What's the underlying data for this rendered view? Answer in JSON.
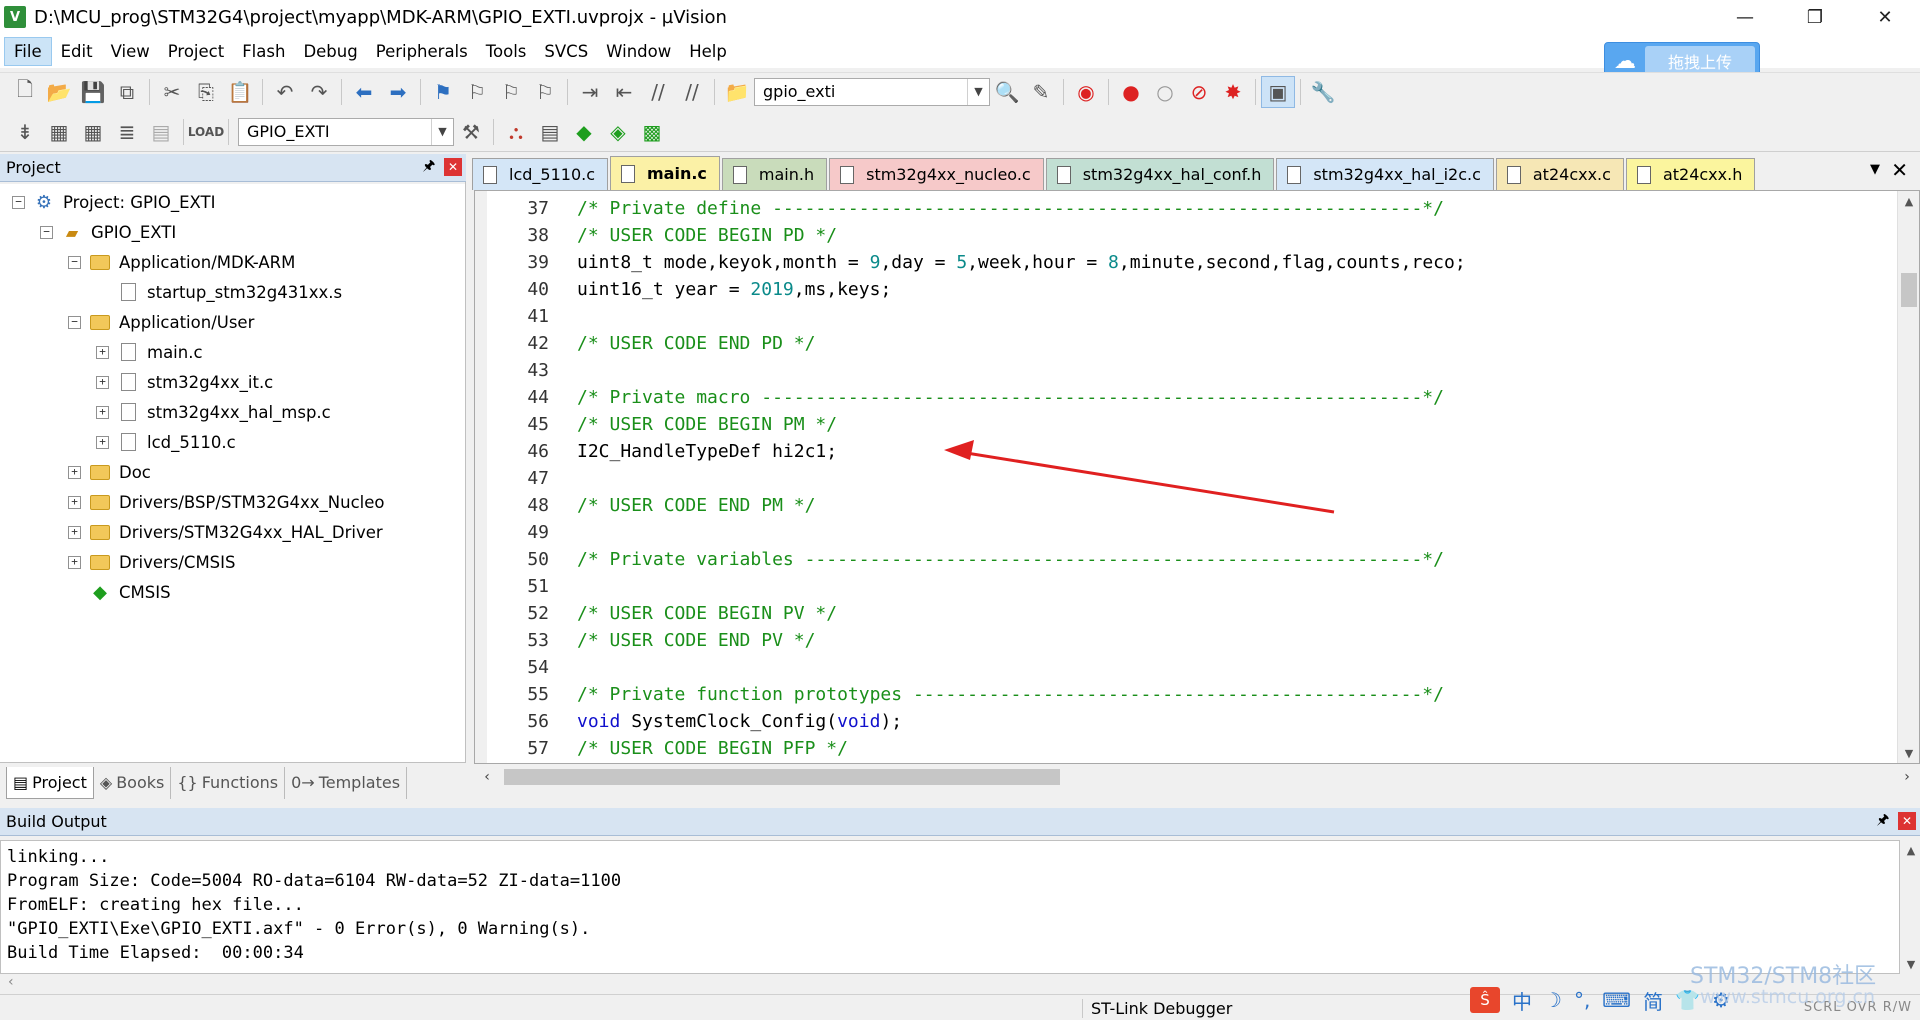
{
  "title": "D:\\MCU_prog\\STM32G4\\project\\myapp\\MDK-ARM\\GPIO_EXTI.uvprojx - µVision",
  "app_icon_label": "V",
  "window_controls": {
    "minimize": "—",
    "maximize": "❐",
    "close": "✕"
  },
  "menu": [
    "File",
    "Edit",
    "View",
    "Project",
    "Flash",
    "Debug",
    "Peripherals",
    "Tools",
    "SVCS",
    "Window",
    "Help"
  ],
  "upload_button": {
    "label": "拖拽上传"
  },
  "toolbar1": {
    "find_combo": "gpio_exti"
  },
  "toolbar2": {
    "target_combo": "GPIO_EXTI"
  },
  "project_panel": {
    "title": "Project",
    "pin": "🖈",
    "close": "✕",
    "tree": [
      {
        "level": 0,
        "exp": "⊟",
        "icon": "project",
        "label": "Project: GPIO_EXTI"
      },
      {
        "level": 1,
        "exp": "⊟",
        "icon": "group",
        "label": "GPIO_EXTI"
      },
      {
        "level": 2,
        "exp": "⊟",
        "icon": "folder",
        "label": "Application/MDK-ARM"
      },
      {
        "level": 3,
        "exp": "",
        "icon": "file",
        "label": "startup_stm32g431xx.s"
      },
      {
        "level": 2,
        "exp": "⊟",
        "icon": "folder",
        "label": "Application/User"
      },
      {
        "level": 3,
        "exp": "⊞",
        "icon": "file",
        "label": "main.c"
      },
      {
        "level": 3,
        "exp": "⊞",
        "icon": "file",
        "label": "stm32g4xx_it.c"
      },
      {
        "level": 3,
        "exp": "⊞",
        "icon": "file",
        "label": "stm32g4xx_hal_msp.c"
      },
      {
        "level": 3,
        "exp": "⊞",
        "icon": "file",
        "label": "lcd_5110.c"
      },
      {
        "level": 2,
        "exp": "⊞",
        "icon": "folder",
        "label": "Doc"
      },
      {
        "level": 2,
        "exp": "⊞",
        "icon": "folder",
        "label": "Drivers/BSP/STM32G4xx_Nucleo"
      },
      {
        "level": 2,
        "exp": "⊞",
        "icon": "folder",
        "label": "Drivers/STM32G4xx_HAL_Driver"
      },
      {
        "level": 2,
        "exp": "⊞",
        "icon": "folder",
        "label": "Drivers/CMSIS"
      },
      {
        "level": 2,
        "exp": "",
        "icon": "cmsis",
        "label": "CMSIS"
      }
    ],
    "tabs": [
      {
        "label": "Project",
        "icon": "▤"
      },
      {
        "label": "Books",
        "icon": "◈"
      },
      {
        "label": "Functions",
        "icon": "{}"
      },
      {
        "label": "Templates",
        "icon": "0→"
      }
    ]
  },
  "editor": {
    "tabs": [
      {
        "label": "lcd_5110.c",
        "bg": "#d4e6f7",
        "active": false
      },
      {
        "label": "main.c",
        "bg": "#fbf1a6",
        "active": true
      },
      {
        "label": "main.h",
        "bg": "#c9dcbb",
        "active": false
      },
      {
        "label": "stm32g4xx_nucleo.c",
        "bg": "#f6c9c9",
        "active": false
      },
      {
        "label": "stm32g4xx_hal_conf.h",
        "bg": "#c2dfd3",
        "active": false
      },
      {
        "label": "stm32g4xx_hal_i2c.c",
        "bg": "#d4e6f7",
        "active": false
      },
      {
        "label": "at24cxx.c",
        "bg": "#f6e7b5",
        "active": false
      },
      {
        "label": "at24cxx.h",
        "bg": "#fbf59e",
        "active": false
      }
    ],
    "tab_menu": "▼",
    "tab_close": "✕",
    "lines": [
      {
        "n": "37",
        "parts": [
          {
            "t": "/* Private define ------------------------------------------------------------*/",
            "c": "comment"
          }
        ]
      },
      {
        "n": "38",
        "parts": [
          {
            "t": "/* USER CODE BEGIN PD */",
            "c": "comment"
          }
        ]
      },
      {
        "n": "39",
        "parts": [
          {
            "t": "uint8_t mode,keyok,month = ",
            "c": "plain"
          },
          {
            "t": "9",
            "c": "num"
          },
          {
            "t": ",day = ",
            "c": "plain"
          },
          {
            "t": "5",
            "c": "num"
          },
          {
            "t": ",week,hour = ",
            "c": "plain"
          },
          {
            "t": "8",
            "c": "num"
          },
          {
            "t": ",minute,second,flag,",
            "c": "plain"
          },
          {
            "t": "counts",
            "c": "hl"
          },
          {
            "t": ",reco;",
            "c": "plain"
          }
        ]
      },
      {
        "n": "40",
        "parts": [
          {
            "t": "uint16_t year = ",
            "c": "plain"
          },
          {
            "t": "2019",
            "c": "num"
          },
          {
            "t": ",ms,keys;",
            "c": "plain"
          }
        ]
      },
      {
        "n": "41",
        "parts": []
      },
      {
        "n": "42",
        "parts": [
          {
            "t": "/* USER CODE END PD */",
            "c": "comment"
          }
        ]
      },
      {
        "n": "43",
        "parts": []
      },
      {
        "n": "44",
        "parts": [
          {
            "t": "/* Private macro -------------------------------------------------------------*/",
            "c": "comment"
          }
        ]
      },
      {
        "n": "45",
        "parts": [
          {
            "t": "/* USER CODE BEGIN PM */",
            "c": "comment"
          }
        ]
      },
      {
        "n": "46",
        "parts": [
          {
            "t": "I2C_HandleTypeDef hi2c1;",
            "c": "plain"
          }
        ]
      },
      {
        "n": "47",
        "parts": []
      },
      {
        "n": "48",
        "parts": [
          {
            "t": "/* USER CODE END PM */",
            "c": "comment"
          }
        ]
      },
      {
        "n": "49",
        "parts": []
      },
      {
        "n": "50",
        "parts": [
          {
            "t": "/* Private variables ---------------------------------------------------------*/",
            "c": "comment"
          }
        ]
      },
      {
        "n": "51",
        "parts": []
      },
      {
        "n": "52",
        "parts": [
          {
            "t": "/* USER CODE BEGIN PV */",
            "c": "comment"
          }
        ]
      },
      {
        "n": "53",
        "parts": [
          {
            "t": "/* USER CODE END PV */",
            "c": "comment"
          }
        ]
      },
      {
        "n": "54",
        "parts": []
      },
      {
        "n": "55",
        "parts": [
          {
            "t": "/* Private function prototypes -----------------------------------------------*/",
            "c": "comment"
          }
        ]
      },
      {
        "n": "56",
        "parts": [
          {
            "t": "void ",
            "c": "kw"
          },
          {
            "t": "SystemClock_Config(",
            "c": "plain"
          },
          {
            "t": "void",
            "c": "kw"
          },
          {
            "t": ");",
            "c": "plain"
          }
        ]
      },
      {
        "n": "57",
        "parts": [
          {
            "t": "/* USER CODE BEGIN PFP */",
            "c": "comment"
          }
        ]
      }
    ]
  },
  "build_output": {
    "title": "Build Output",
    "lines": [
      "linking...",
      "Program Size: Code=5004 RO-data=6104 RW-data=52 ZI-data=1100",
      "FromELF: creating hex file...",
      "\"GPIO_EXTI\\Exe\\GPIO_EXTI.axf\" - 0 Error(s), 0 Warning(s).",
      "Build Time Elapsed:  00:00:34"
    ]
  },
  "statusbar": {
    "debugger": "ST-Link Debugger",
    "indicators": "SCRL OVR R/W"
  },
  "ime": {
    "logo": "Ŝ",
    "items": [
      "中",
      "☽",
      "°,",
      "⌨",
      "简",
      "👕",
      "⚙"
    ]
  },
  "watermark": {
    "line1": "STM32/STM8社区",
    "line2": "www.stmcu.org.cn"
  },
  "accent_arrow_color": "#e02020"
}
